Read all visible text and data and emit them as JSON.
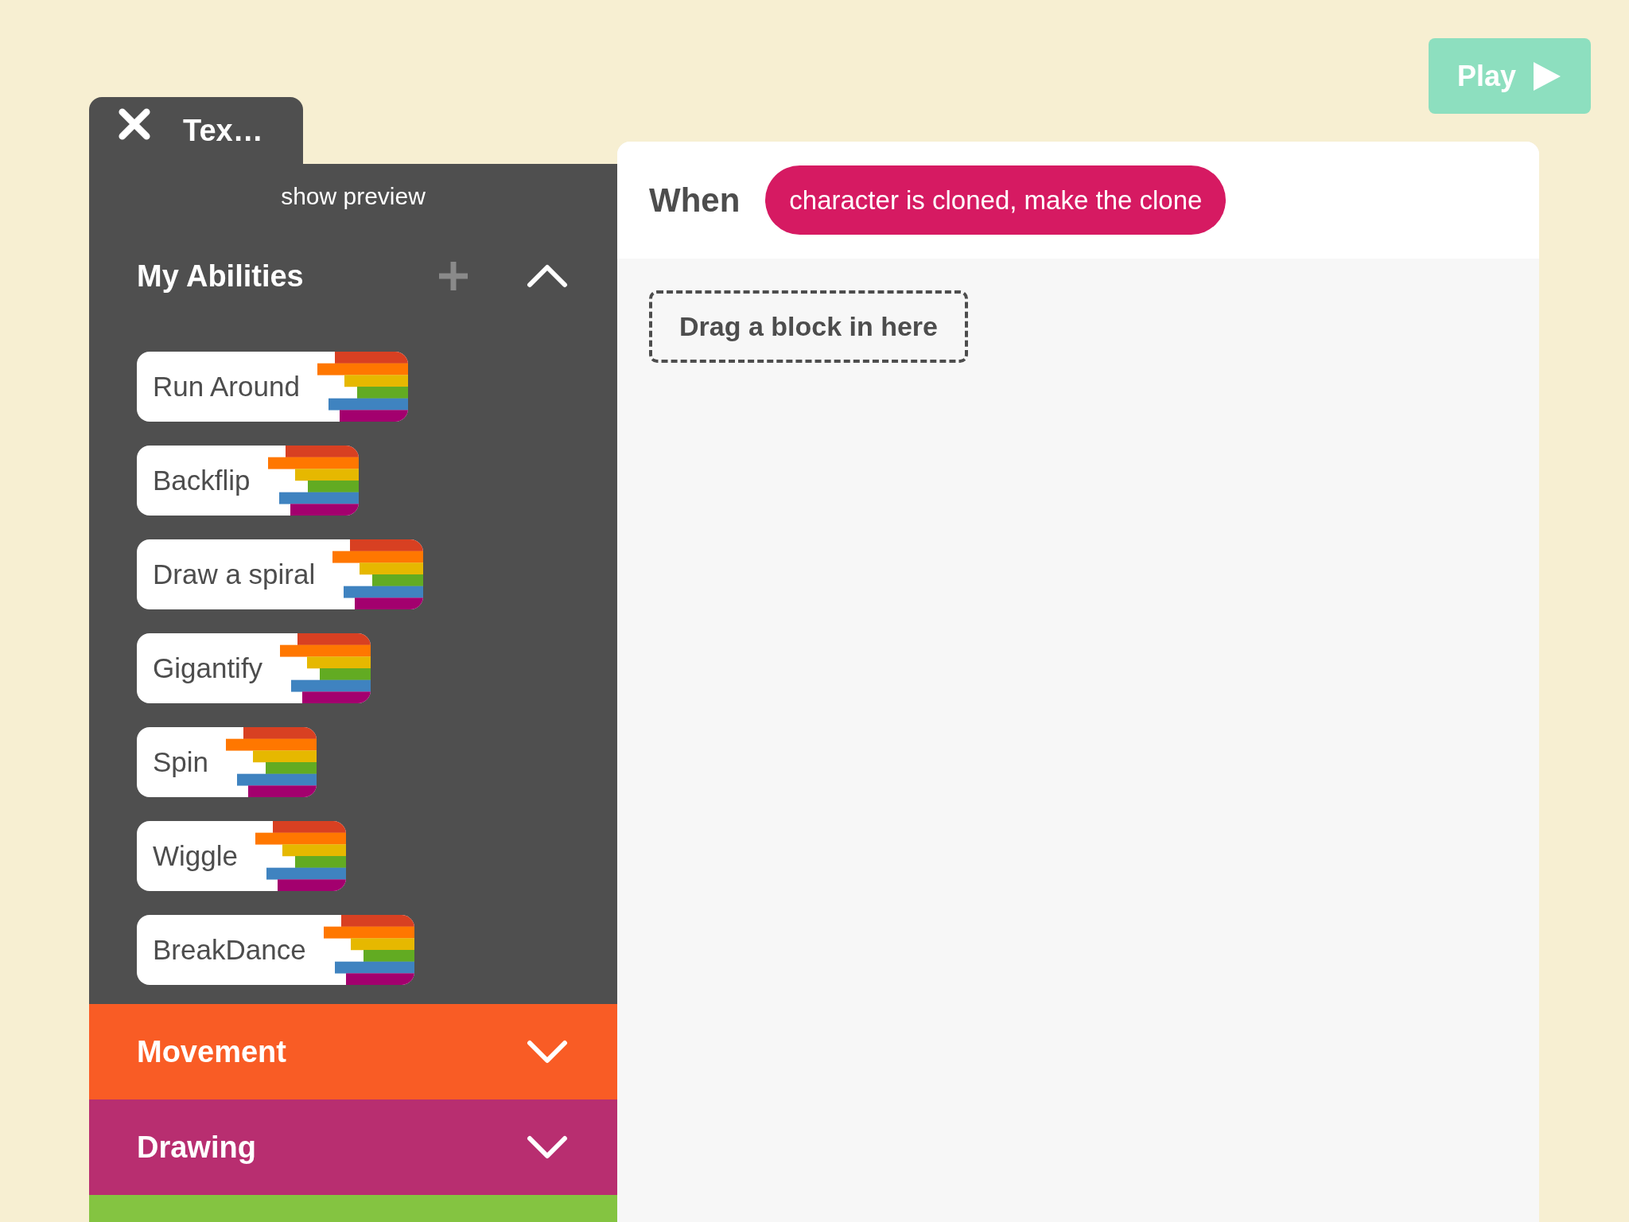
{
  "play_button": {
    "label": "Play"
  },
  "panel": {
    "tab_title": "Tex…",
    "preview_link": "show preview",
    "abilities": {
      "title": "My Abilities",
      "expanded": true,
      "items": [
        {
          "label": "Run Around"
        },
        {
          "label": "Backflip"
        },
        {
          "label": "Draw a spiral"
        },
        {
          "label": "Gigantify"
        },
        {
          "label": "Spin"
        },
        {
          "label": "Wiggle"
        },
        {
          "label": "BreakDance"
        }
      ]
    },
    "categories": [
      {
        "label": "Movement",
        "color": "#f95c25",
        "expanded": false
      },
      {
        "label": "Drawing",
        "color": "#b82e70",
        "expanded": false
      },
      {
        "color": "#84c441"
      }
    ]
  },
  "editor": {
    "when_label": "When",
    "trigger": "character is cloned, make the clone",
    "drop_hint": "Drag a block in here"
  }
}
